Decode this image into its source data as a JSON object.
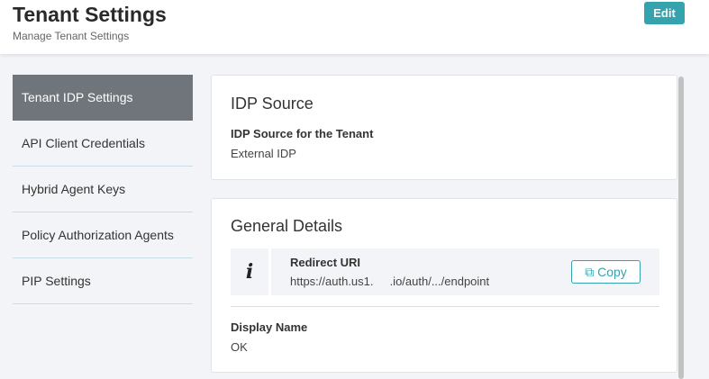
{
  "header": {
    "title": "Tenant Settings",
    "subtitle": "Manage Tenant Settings",
    "edit_label": "Edit"
  },
  "sidebar": {
    "items": [
      {
        "label": "Tenant IDP Settings",
        "active": true
      },
      {
        "label": "API Client Credentials"
      },
      {
        "label": "Hybrid Agent Keys"
      },
      {
        "label": "Policy Authorization Agents"
      },
      {
        "label": "PIP Settings"
      }
    ]
  },
  "idp_source": {
    "heading": "IDP Source",
    "label": "IDP Source for the Tenant",
    "value": "External IDP"
  },
  "general": {
    "heading": "General Details",
    "redirect_label": "Redirect URI",
    "redirect_value": "https://auth.us1.     .io/auth/.../endpoint",
    "copy_label": "Copy",
    "display_name_label": "Display Name",
    "display_name_value": "OK"
  },
  "colors": {
    "accent": "#35a3ad",
    "active_nav": "#6f757b"
  }
}
